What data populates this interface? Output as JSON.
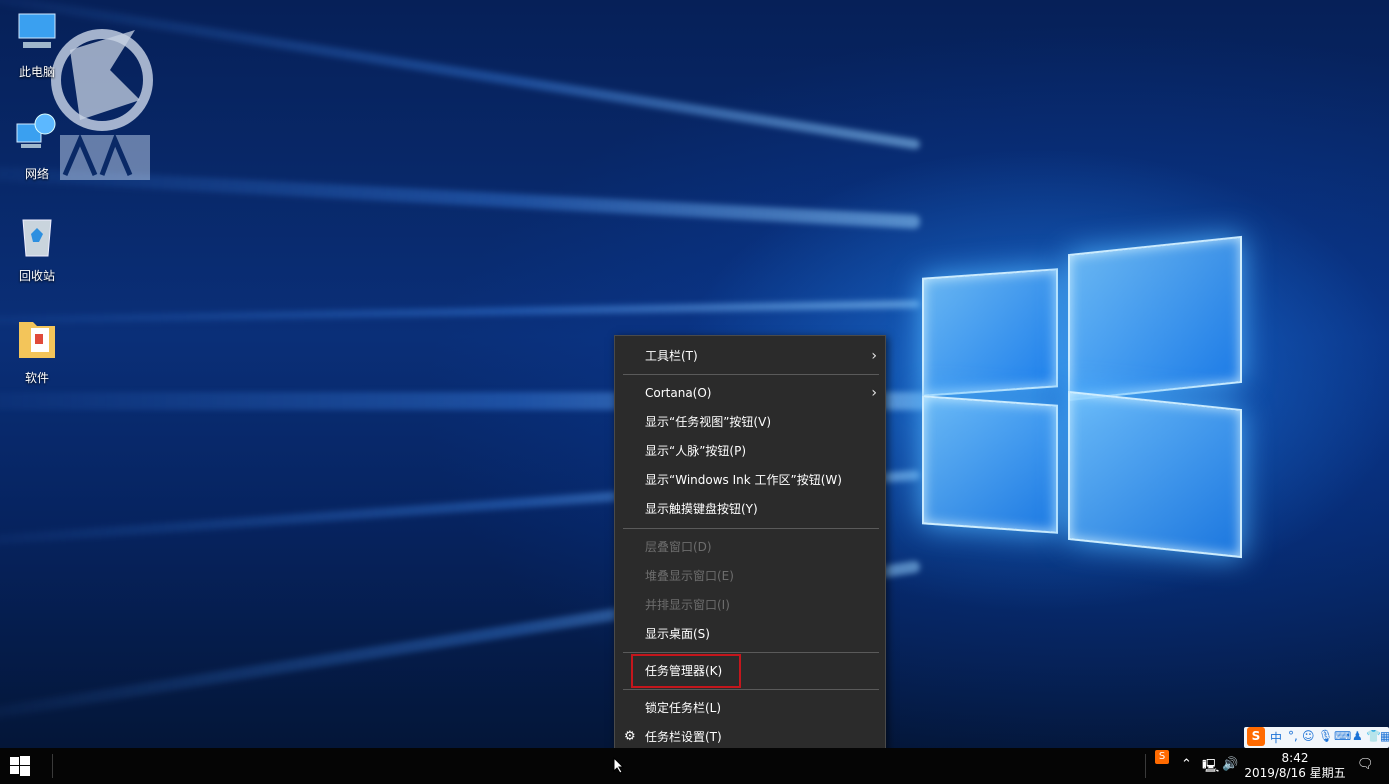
{
  "desktop": {
    "icons": [
      {
        "label": "此电脑",
        "icon": "computer-icon"
      },
      {
        "label": "网络",
        "icon": "network-icon"
      },
      {
        "label": "回收站",
        "icon": "recycle-bin-icon"
      },
      {
        "label": "软件",
        "icon": "folder-icon"
      }
    ]
  },
  "context_menu": {
    "items": [
      {
        "label": "工具栏(T)",
        "submenu": true,
        "enabled": true
      },
      {
        "label": "Cortana(O)",
        "submenu": true,
        "enabled": true
      },
      {
        "label": "显示“任务视图”按钮(V)",
        "enabled": true
      },
      {
        "label": "显示“人脉”按钮(P)",
        "enabled": true
      },
      {
        "label": "显示“Windows Ink 工作区”按钮(W)",
        "enabled": true
      },
      {
        "label": "显示触摸键盘按钮(Y)",
        "enabled": true
      },
      {
        "label": "层叠窗口(D)",
        "enabled": false
      },
      {
        "label": "堆叠显示窗口(E)",
        "enabled": false
      },
      {
        "label": "并排显示窗口(I)",
        "enabled": false
      },
      {
        "label": "显示桌面(S)",
        "enabled": true
      },
      {
        "label": "任务管理器(K)",
        "enabled": true,
        "highlighted": true
      },
      {
        "label": "锁定任务栏(L)",
        "enabled": true
      },
      {
        "label": "任务栏设置(T)",
        "enabled": true,
        "icon": "gear-icon"
      }
    ],
    "highlight_color": "#c4161c"
  },
  "ime_bar": {
    "logo": "S",
    "mode": "中",
    "punct": "°,"
  },
  "taskbar": {
    "time": "8:42",
    "date": "2019/8/16 星期五"
  },
  "colors": {
    "menu_bg": "#2b2b2b",
    "taskbar_bg": "#050505",
    "wallpaper_accent": "#1e88ff"
  }
}
